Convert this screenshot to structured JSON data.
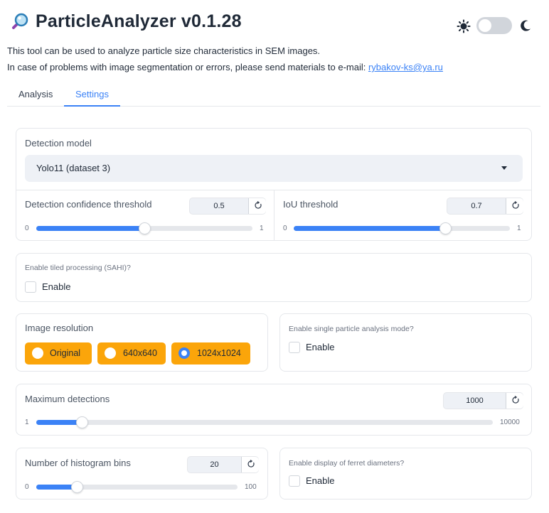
{
  "app": {
    "title": "ParticleAnalyzer v0.1.28",
    "description_line1": "This tool can be used to analyze particle size characteristics in SEM images.",
    "description_line2": "In case of problems with image segmentation or errors, please send materials to e-mail: ",
    "email": "rybakov-ks@ya.ru"
  },
  "theme_toggle": {
    "mode": "light",
    "light_icon": "sun-icon",
    "dark_icon": "moon-icon"
  },
  "tabs": [
    {
      "label": "Analysis",
      "active": false
    },
    {
      "label": "Settings",
      "active": true
    }
  ],
  "detection_model": {
    "label": "Detection model",
    "value": "Yolo11 (dataset 3)"
  },
  "confidence": {
    "label": "Detection confidence threshold",
    "value": "0.5",
    "min": "0",
    "max": "1",
    "fraction": 0.5
  },
  "iou": {
    "label": "IoU threshold",
    "value": "0.7",
    "min": "0",
    "max": "1",
    "fraction": 0.7
  },
  "sahi": {
    "label": "Enable tiled processing (SAHI)?",
    "checkbox_label": "Enable",
    "checked": false
  },
  "resolution": {
    "label": "Image resolution",
    "options": [
      "Original",
      "640x640",
      "1024x1024"
    ],
    "selected": "1024x1024"
  },
  "single_particle": {
    "label": "Enable single particle analysis mode?",
    "checkbox_label": "Enable",
    "checked": false
  },
  "max_detections": {
    "label": "Maximum detections",
    "value": "1000",
    "min": "1",
    "max": "10000",
    "fraction": 0.1
  },
  "histogram_bins": {
    "label": "Number of histogram bins",
    "value": "20",
    "min": "0",
    "max": "100",
    "fraction": 0.2
  },
  "ferret": {
    "label": "Enable display of ferret diameters?",
    "checkbox_label": "Enable",
    "checked": false
  },
  "colors": {
    "accent": "#3b82f6",
    "radio_bg": "#fba50a",
    "border": "#e5e7eb"
  }
}
